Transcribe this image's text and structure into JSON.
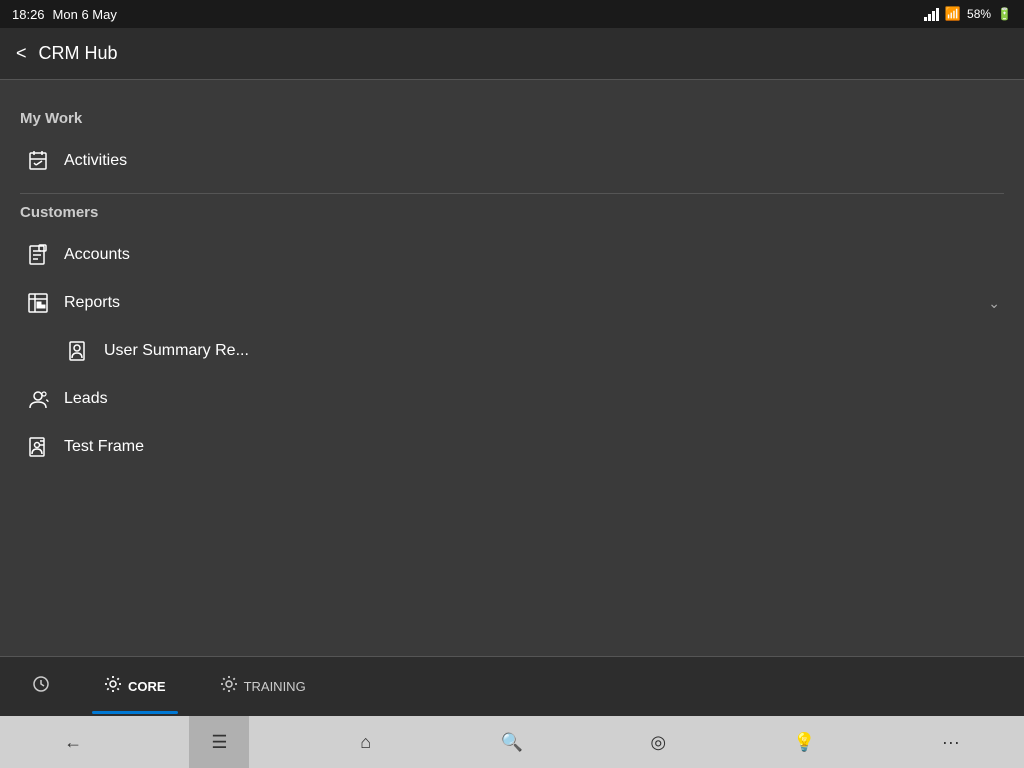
{
  "statusBar": {
    "time": "18:26",
    "date": "Mon 6 May",
    "battery": "58%",
    "batteryIcon": "battery-icon"
  },
  "header": {
    "backLabel": "<",
    "title": "CRM Hub"
  },
  "sections": [
    {
      "id": "my-work",
      "heading": "My Work",
      "items": [
        {
          "id": "activities",
          "label": "Activities",
          "icon": "activities-icon",
          "hasChevron": false,
          "isSubItem": false
        }
      ]
    },
    {
      "id": "customers",
      "heading": "Customers",
      "items": [
        {
          "id": "accounts",
          "label": "Accounts",
          "icon": "accounts-icon",
          "hasChevron": false,
          "isSubItem": false
        },
        {
          "id": "reports",
          "label": "Reports",
          "icon": "reports-icon",
          "hasChevron": true,
          "isSubItem": false
        },
        {
          "id": "user-summary",
          "label": "User Summary Re...",
          "icon": "user-summary-icon",
          "hasChevron": false,
          "isSubItem": true
        },
        {
          "id": "leads",
          "label": "Leads",
          "icon": "leads-icon",
          "hasChevron": false,
          "isSubItem": false
        },
        {
          "id": "test-frame",
          "label": "Test Frame",
          "icon": "test-frame-icon",
          "hasChevron": false,
          "isSubItem": false
        }
      ]
    }
  ],
  "bottomTabs": [
    {
      "id": "recent",
      "icon": "recent-icon",
      "label": ""
    },
    {
      "id": "core",
      "icon": "gear-icon",
      "label": "CORE",
      "active": true
    },
    {
      "id": "training",
      "icon": "gear2-icon",
      "label": "TRAINING"
    }
  ],
  "navBar": {
    "buttons": [
      {
        "id": "back",
        "icon": "←"
      },
      {
        "id": "menu",
        "icon": "≡",
        "active": true
      },
      {
        "id": "home",
        "icon": "⌂"
      },
      {
        "id": "search",
        "icon": "⌕"
      },
      {
        "id": "target",
        "icon": "◎"
      },
      {
        "id": "lightbulb",
        "icon": "💡"
      },
      {
        "id": "more",
        "icon": "···"
      }
    ]
  }
}
